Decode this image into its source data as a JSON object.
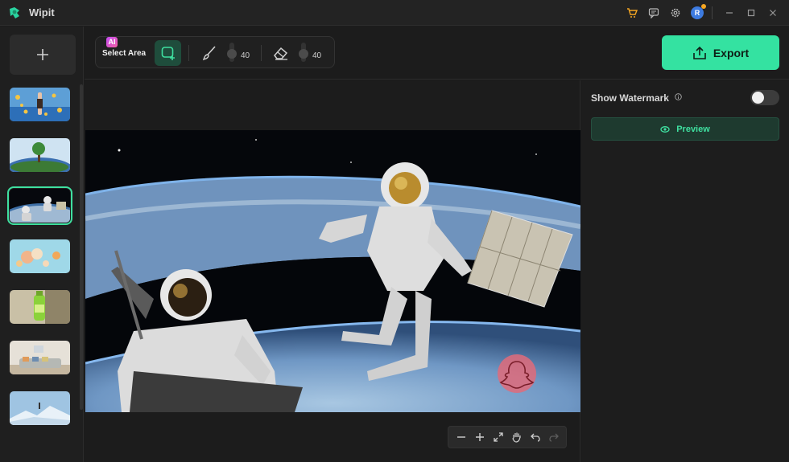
{
  "app": {
    "title": "Wipit"
  },
  "titlebar": {
    "icons": [
      "cart-icon",
      "feedback-icon",
      "settings-icon",
      "avatar",
      "minimize-icon",
      "maximize-icon",
      "close-icon"
    ],
    "avatar_initial": "R"
  },
  "rail": {
    "add_icon": "plus-icon",
    "thumbnails": [
      {
        "name": "thumb-stars-woman",
        "active": false
      },
      {
        "name": "thumb-planet-tree",
        "active": false
      },
      {
        "name": "thumb-astronauts",
        "active": true
      },
      {
        "name": "thumb-ice-cream",
        "active": false
      },
      {
        "name": "thumb-green-bottle",
        "active": false
      },
      {
        "name": "thumb-living-room",
        "active": false
      },
      {
        "name": "thumb-snow-mountain",
        "active": false
      }
    ]
  },
  "toolbar": {
    "ai_badge": "AI",
    "select_area_label": "Select Area",
    "brush_size": "40",
    "eraser_size": "40",
    "export_label": "Export"
  },
  "panel": {
    "watermark_label": "Show Watermark",
    "watermark_on": false,
    "preview_label": "Preview"
  },
  "colors": {
    "accent": "#34e2a1",
    "accent_dark": "#1e3a2f",
    "background": "#1c1c1c"
  }
}
